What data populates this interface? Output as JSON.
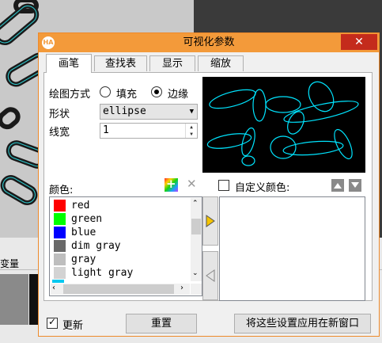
{
  "background": {
    "label": "变量"
  },
  "dialog": {
    "title": "可视化参数",
    "logo": "HA",
    "close_icon": "✕"
  },
  "tabs": [
    {
      "label": "画笔",
      "active": true
    },
    {
      "label": "查找表",
      "active": false
    },
    {
      "label": "显示",
      "active": false
    },
    {
      "label": "缩放",
      "active": false
    }
  ],
  "pen": {
    "draw_mode_label": "绘图方式",
    "fill_label": "填充",
    "edge_label": "边缘",
    "draw_mode_selected": "边缘",
    "shape_label": "形状",
    "shape_value": "ellipse",
    "line_width_label": "线宽",
    "line_width_value": "1"
  },
  "colors": {
    "label": "颜色:",
    "items": [
      {
        "name": "red",
        "hex": "#ff0000"
      },
      {
        "name": "green",
        "hex": "#00ff00"
      },
      {
        "name": "blue",
        "hex": "#0000ff"
      },
      {
        "name": "dim gray",
        "hex": "#696969"
      },
      {
        "name": "gray",
        "hex": "#bebebe"
      },
      {
        "name": "light gray",
        "hex": "#d3d3d3"
      }
    ],
    "custom_label": "自定义颜色:",
    "custom_checked": false
  },
  "footer": {
    "update_label": "更新",
    "update_checked": true,
    "reset_label": "重置",
    "apply_label": "将这些设置应用在新窗口"
  },
  "theme": {
    "accent": "#f39a3a",
    "close": "#c42b1c",
    "preview_stroke": "#00e5ff"
  },
  "icons": {
    "add_color": "add-color-icon",
    "remove_color": "remove-color-icon",
    "move_right": "arrow-right-icon",
    "move_left": "arrow-left-icon",
    "move_up": "arrow-up-icon",
    "move_down": "arrow-down-icon"
  }
}
